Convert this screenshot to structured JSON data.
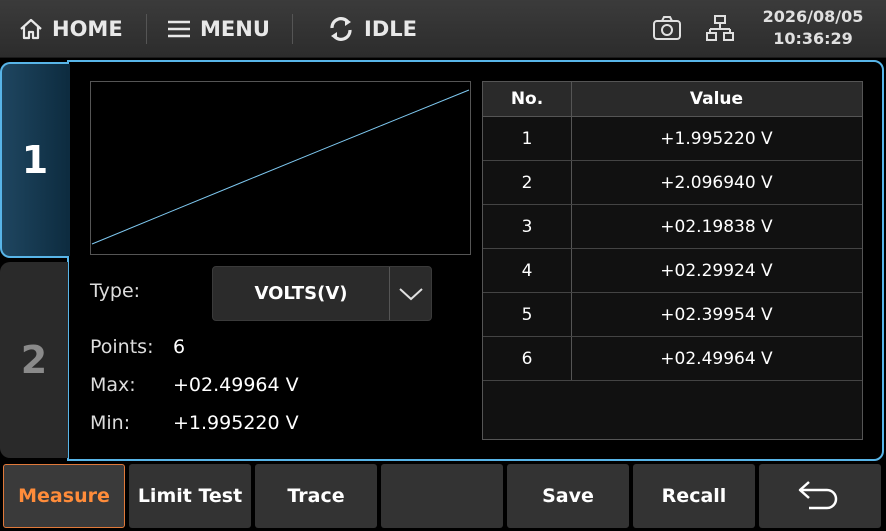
{
  "topbar": {
    "home_label": "HOME",
    "menu_label": "MENU",
    "status_label": "IDLE",
    "date": "2026/08/05",
    "time": "10:36:29"
  },
  "tabs": [
    {
      "label": "1",
      "active": true
    },
    {
      "label": "2",
      "active": false
    }
  ],
  "chart_data": {
    "type": "line",
    "x": [
      1,
      2,
      3,
      4,
      5,
      6
    ],
    "values": [
      1.99522,
      2.09694,
      2.19838,
      2.29924,
      2.39954,
      2.49964
    ],
    "ylim": [
      1.99522,
      2.49964
    ],
    "line_color": "#7ec8f0",
    "grid": false
  },
  "settings": {
    "type_label": "Type:",
    "type_value": "VOLTS(V)",
    "points_label": "Points:",
    "points_value": "6",
    "max_label": "Max:",
    "max_value": "+02.49964 V",
    "min_label": "Min:",
    "min_value": "+1.995220 V"
  },
  "table": {
    "headers": [
      "No.",
      "Value"
    ],
    "rows": [
      {
        "no": "1",
        "value": "+1.995220 V"
      },
      {
        "no": "2",
        "value": "+2.096940 V"
      },
      {
        "no": "3",
        "value": "+02.19838 V"
      },
      {
        "no": "4",
        "value": "+02.29924 V"
      },
      {
        "no": "5",
        "value": "+02.39954 V"
      },
      {
        "no": "6",
        "value": "+02.49964 V"
      }
    ]
  },
  "bottombar": {
    "measure": "Measure",
    "limit_test": "Limit Test",
    "trace": "Trace",
    "blank": "",
    "save": "Save",
    "recall": "Recall"
  },
  "colors": {
    "accent": "#58b5e8",
    "active_button": "#ff8c3a"
  }
}
